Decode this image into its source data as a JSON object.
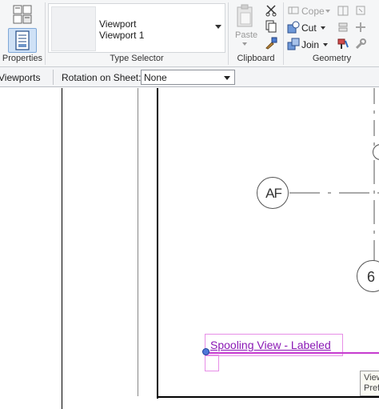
{
  "ribbon": {
    "properties_label": "Properties",
    "type_selector": {
      "line1": "Viewport",
      "line2": "Viewport 1",
      "panel_label": "Type Selector"
    },
    "clipboard": {
      "paste_label": "Paste",
      "panel_label": "Clipboard"
    },
    "geometry": {
      "cope_label": "Cope",
      "cut_label": "Cut",
      "join_label": "Join",
      "panel_label": "Geometry"
    }
  },
  "options_bar": {
    "viewports_label": "Viewports",
    "rotation_label": "Rotation on Sheet:",
    "rotation_value": "None"
  },
  "canvas": {
    "grid_bubble_af": "AF",
    "grid_bubble_6": "6",
    "view_title": "Spooling View - Labeled",
    "tooltip_line1": "View",
    "tooltip_line2": "Pref"
  },
  "colors": {
    "label_text": "#8a18b5",
    "label_line": "#c63ccf",
    "selection_box": "#e78ee7",
    "properties_button_bg": "#cfe1f6"
  }
}
